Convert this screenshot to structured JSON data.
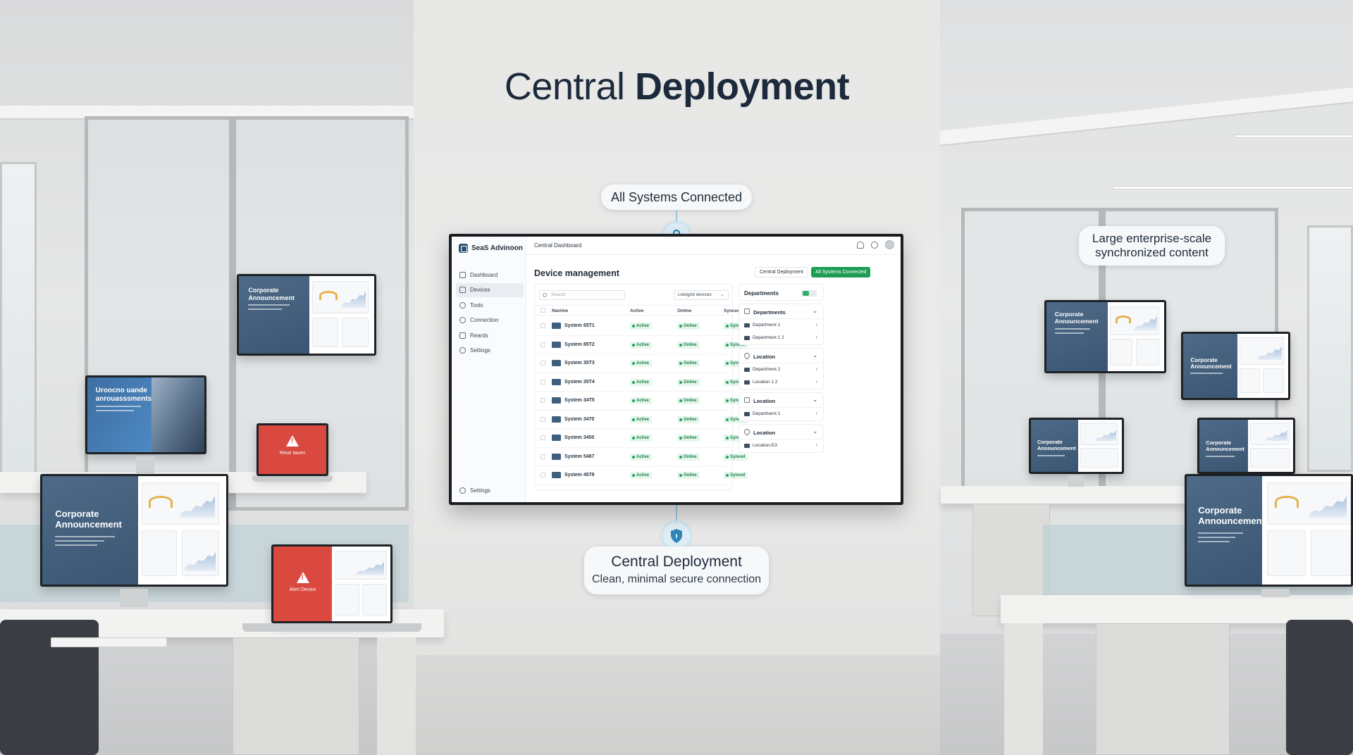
{
  "hero": {
    "title_light": "Central ",
    "title_bold": "Deployment"
  },
  "callouts": {
    "connected": "All Systems Connected",
    "enterprise_line1": "Large enterprise-scale",
    "enterprise_line2": "synchronized content",
    "central_title": "Central Deployment",
    "central_sub": "Clean, minimal secure connection"
  },
  "icons": {
    "top_badge": "lock-icon",
    "bottom_badge": "shield-icon"
  },
  "colors": {
    "accent_green": "#1f9d55",
    "navy": "#3b5673",
    "alert_red": "#d9493f",
    "connector_blue": "#9bc6dc"
  },
  "dashboard": {
    "brand": "SeaS Advinoon",
    "topbar_title": "Central Dashboard",
    "nav": [
      {
        "label": "Dashboard",
        "icon": "home-icon"
      },
      {
        "label": "Devices",
        "icon": "devices-icon"
      },
      {
        "label": "Tools",
        "icon": "user-icon"
      },
      {
        "label": "Connection",
        "icon": "connection-icon"
      },
      {
        "label": "Reards",
        "icon": "reports-icon"
      },
      {
        "label": "Settings",
        "icon": "gear-icon"
      }
    ],
    "sidebar_footer": "Settings",
    "page_title": "Device management",
    "btn_central": "Central Deployment",
    "btn_connected": "All Systems Connected",
    "search_placeholder": "Search",
    "dropdown_label": "Liskigrid devices",
    "columns": {
      "name": "Navime",
      "active": "Active",
      "online": "Online",
      "synced": "Synced"
    },
    "rows": [
      {
        "name": "System 65T1",
        "active": "Active",
        "online": "Online",
        "synced": "Synced"
      },
      {
        "name": "System 85T2",
        "active": "Active",
        "online": "Online",
        "synced": "Synced"
      },
      {
        "name": "System 35T3",
        "active": "Active",
        "online": "Online",
        "synced": "Synced"
      },
      {
        "name": "System 35T4",
        "active": "Active",
        "online": "Online",
        "synced": "Synced"
      },
      {
        "name": "System 34T5",
        "active": "Active",
        "online": "Online",
        "synced": "Synced"
      },
      {
        "name": "System 3470",
        "active": "Active",
        "online": "Online",
        "synced": "Synced"
      },
      {
        "name": "System 3450",
        "active": "Active",
        "online": "Online",
        "synced": "Synced"
      },
      {
        "name": "System 5487",
        "active": "Active",
        "online": "Online",
        "synced": "Synced"
      },
      {
        "name": "System 4579",
        "active": "Active",
        "online": "Online",
        "synced": "Synced"
      }
    ],
    "right_panel": {
      "title": "Departments",
      "groups": [
        {
          "title": "Departments",
          "items": [
            "Department 1",
            "Department 1 2"
          ]
        },
        {
          "title": "Location",
          "items": [
            "Department 2",
            "Location 1 2"
          ]
        },
        {
          "title": "Location",
          "items": [
            "Departtoent 1"
          ]
        },
        {
          "title": "Location",
          "items": [
            "Location-E3"
          ]
        }
      ]
    }
  },
  "screens": {
    "corporate": "Corporate Announcement",
    "upcoming": "Uroocno uande anrouasssments",
    "alert_small": "Reue tauon",
    "alert_laptop": "Alert Device"
  }
}
